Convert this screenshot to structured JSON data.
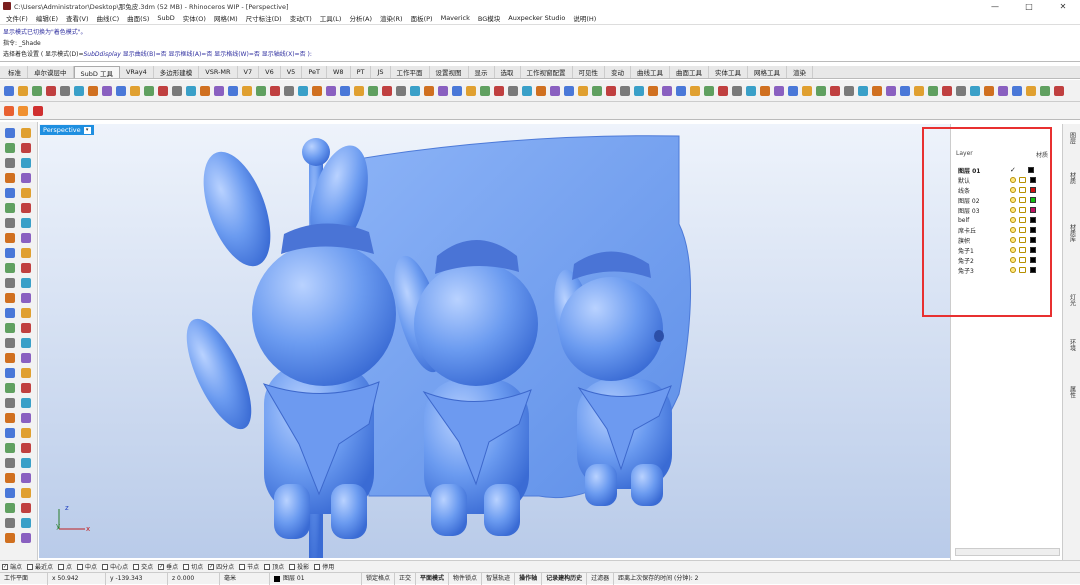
{
  "window": {
    "title": "C:\\Users\\Administrator\\Desktop\\那兔皮.3dm (52 MB) - Rhinoceros WIP - [Perspective]",
    "controls": [
      "—",
      "□",
      "✕"
    ]
  },
  "menu": [
    "文件(F)",
    "编辑(E)",
    "查看(V)",
    "曲线(C)",
    "曲面(S)",
    "SubD",
    "实体(O)",
    "网格(M)",
    "尺寸标注(D)",
    "变动(T)",
    "工具(L)",
    "分析(A)",
    "渲染(R)",
    "面板(P)",
    "Maverick",
    "BG模块",
    "Auxpecker Studio",
    "说明(H)"
  ],
  "command": {
    "history": "显示模式已切换为\"着色模式\"。",
    "prompt_line": "指令: _Shade",
    "options_prefix": "选择着色设置 ( 显示模式(D)=",
    "options_value": "SubDdisplay",
    "options_rest": " 显示曲线(B)=否 显示框线(A)=否 显示格线(W)=否 显示轴线(X)=否 ):"
  },
  "tabs": [
    "标准",
    "卓尔谟层中",
    "SubD 工具",
    "VRay4",
    "多边形建模",
    "VSR-MR",
    "V7",
    "V6",
    "V5",
    "PeT",
    "W8",
    "PT",
    "JS",
    "工作平面",
    "设置视图",
    "显示",
    "选取",
    "工作视窗配置",
    "可见性",
    "变动",
    "曲线工具",
    "曲面工具",
    "实体工具",
    "网格工具",
    "渲染"
  ],
  "active_tab": "SubD 工具",
  "viewport": {
    "label": "Perspective",
    "axis_x": "x",
    "axis_y": "y",
    "axis_z": "z"
  },
  "layers": {
    "header_name": "Layer",
    "header_material": "材质",
    "rows": [
      {
        "name": "图层 01",
        "current": "✓",
        "color": "#000000",
        "bold": true
      },
      {
        "name": "默认",
        "color": "#000000"
      },
      {
        "name": "线条",
        "color": "#d01010"
      },
      {
        "name": "图层 02",
        "color": "#10c010"
      },
      {
        "name": "图层 03",
        "color": "#c01060"
      },
      {
        "name": "belf",
        "color": "#000000"
      },
      {
        "name": "席卡丘",
        "color": "#000000"
      },
      {
        "name": "旗帜",
        "color": "#000000"
      },
      {
        "name": "兔子1",
        "color": "#000000"
      },
      {
        "name": "兔子2",
        "color": "#000000"
      },
      {
        "name": "兔子3",
        "color": "#000000"
      }
    ]
  },
  "side_tabs": [
    "图层",
    "材质",
    "材质库",
    "灯光",
    "环境",
    "属性"
  ],
  "osnap": [
    {
      "label": "端点",
      "checked": true
    },
    {
      "label": "最近点",
      "checked": false
    },
    {
      "label": "点",
      "checked": false
    },
    {
      "label": "中点",
      "checked": false
    },
    {
      "label": "中心点",
      "checked": false
    },
    {
      "label": "交点",
      "checked": false
    },
    {
      "label": "垂点",
      "checked": true
    },
    {
      "label": "切点",
      "checked": false
    },
    {
      "label": "四分点",
      "checked": true
    },
    {
      "label": "节点",
      "checked": false
    },
    {
      "label": "顶点",
      "checked": false
    },
    {
      "label": "投影",
      "checked": false
    },
    {
      "label": "停用",
      "checked": false
    }
  ],
  "status": {
    "cplane": "工作平面",
    "x": "x 50.942",
    "y": "y -139.343",
    "z": "z 0.000",
    "unit": "毫米",
    "layer": "图层 01",
    "items": [
      "锁定格点",
      "正交",
      "平面模式",
      "物件锁点",
      "智慧轨迹",
      "操作轴",
      "记录建构历史",
      "过滤器",
      "距离上次保存的时间 (分钟): 2"
    ]
  },
  "colors": {
    "accent": "#1f8fe0",
    "highlight": "#e83030",
    "model": "#6b9bf0"
  },
  "icons": [
    "rhino-app-icon",
    "select-arrow-icon",
    "point-icon",
    "polyline-icon",
    "circle-icon",
    "arc-icon",
    "rectangle-icon",
    "polygon-icon",
    "curve-icon",
    "surface-icon",
    "extrude-icon",
    "box-icon",
    "sphere-icon",
    "boolean-icon",
    "mesh-icon",
    "move-icon",
    "rotate-icon",
    "scale-icon",
    "mirror-icon",
    "array-icon",
    "trim-icon",
    "split-icon",
    "join-icon",
    "explode-icon",
    "render-icon",
    "layer-icon",
    "material-icon",
    "light-icon",
    "properties-icon"
  ]
}
